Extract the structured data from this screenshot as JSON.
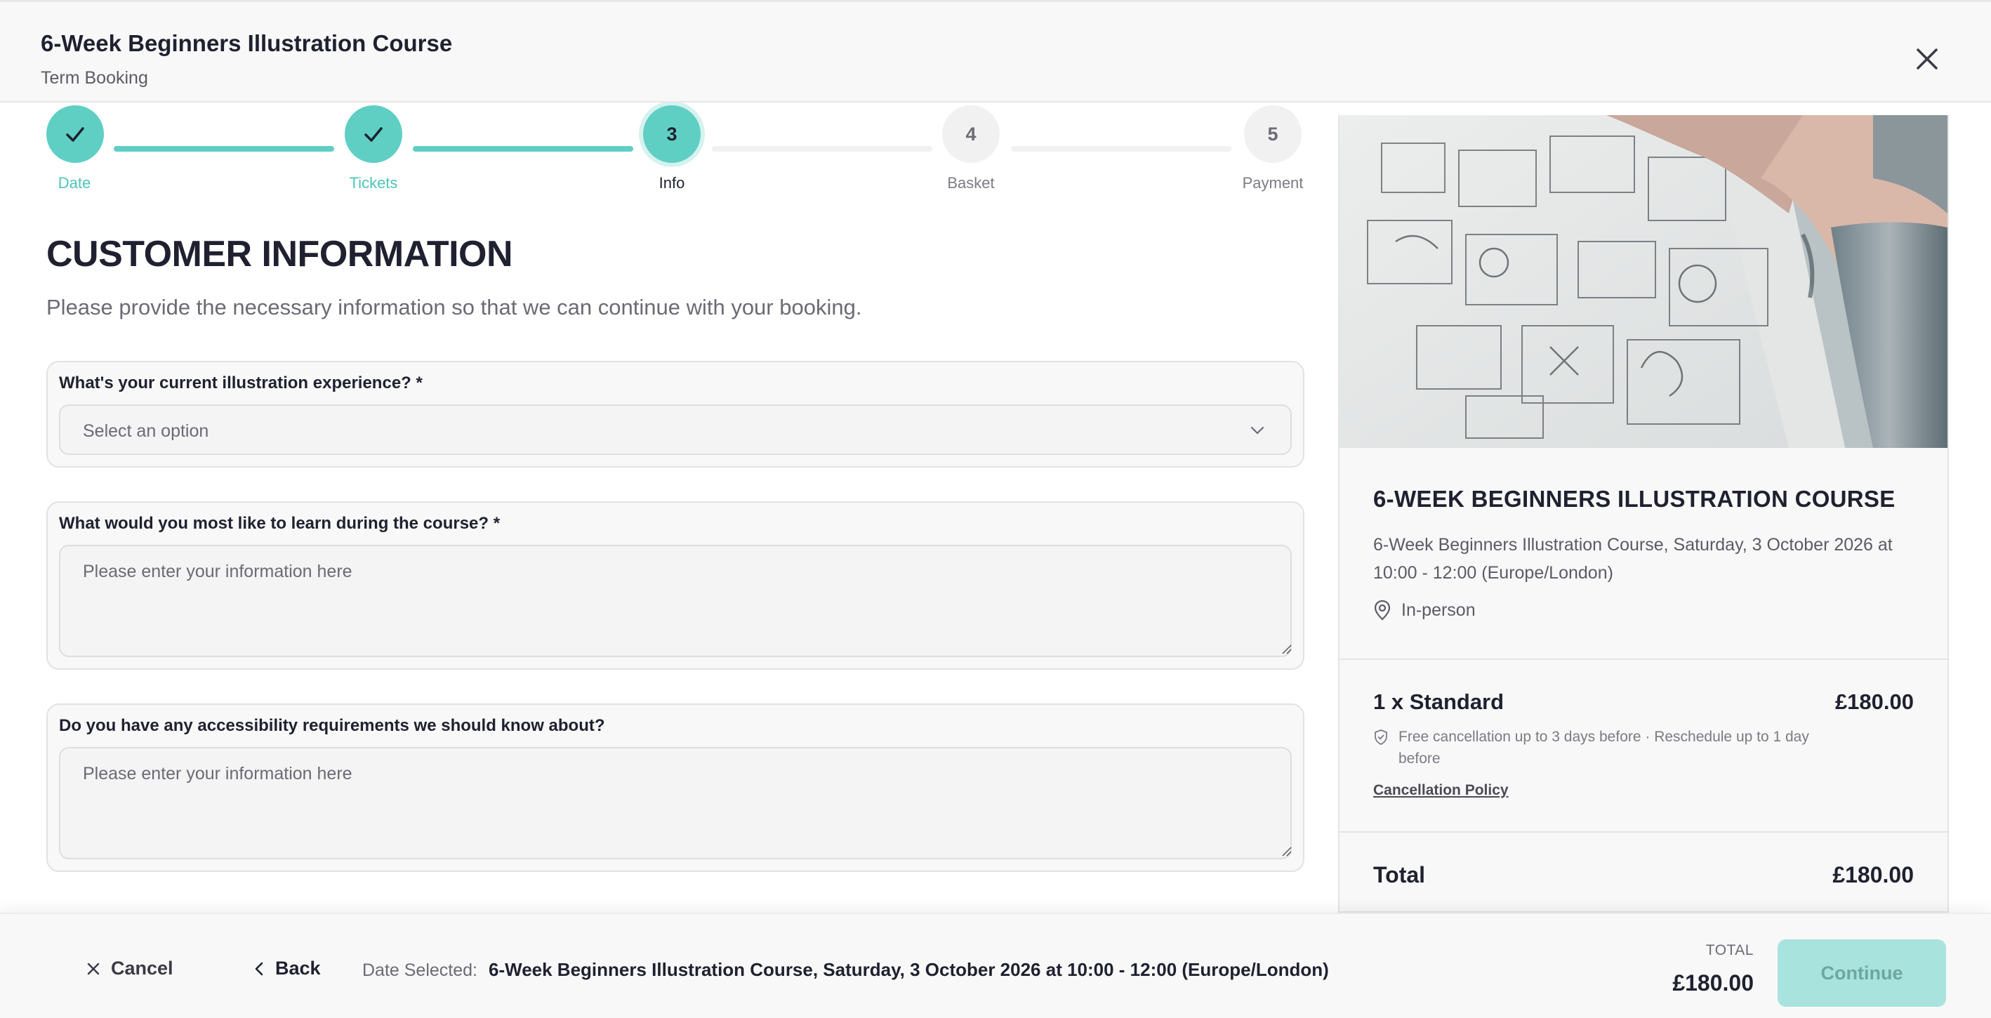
{
  "header": {
    "title": "6-Week Beginners Illustration Course",
    "subtitle": "Term Booking"
  },
  "stepper": {
    "steps": [
      {
        "label": "Date",
        "number": "1",
        "state": "done"
      },
      {
        "label": "Tickets",
        "number": "2",
        "state": "done"
      },
      {
        "label": "Info",
        "number": "3",
        "state": "active"
      },
      {
        "label": "Basket",
        "number": "4",
        "state": "todo"
      },
      {
        "label": "Payment",
        "number": "5",
        "state": "todo"
      }
    ]
  },
  "form": {
    "heading": "CUSTOMER INFORMATION",
    "description": "Please provide the necessary information so that we can continue with your booking.",
    "questions": [
      {
        "label": "What's your current illustration experience? *",
        "placeholder": "Select an option"
      },
      {
        "label": "What would you most like to learn during the course? *",
        "placeholder": "Please enter your information here"
      },
      {
        "label": "Do you have any accessibility requirements we should know about?",
        "placeholder": "Please enter your information here"
      }
    ]
  },
  "summary": {
    "course_title": "6-WEEK BEGINNERS ILLUSTRATION COURSE",
    "course_desc": "6-Week Beginners Illustration Course, Saturday, 3 October 2026 at 10:00 - 12:00 (Europe/London)",
    "location": "In-person",
    "ticket_name": "1 x Standard",
    "ticket_price": "£180.00",
    "ticket_note": "Free cancellation up to 3 days before · Reschedule up to 1 day before",
    "cancellation_link": "Cancellation Policy",
    "total_label": "Total",
    "total_value": "£180.00"
  },
  "footer": {
    "cancel": "Cancel",
    "back": "Back",
    "date_label": "Date Selected:",
    "date_value": "6-Week Beginners Illustration Course, Saturday, 3 October 2026 at 10:00 - 12:00 (Europe/London)",
    "total_caption": "TOTAL",
    "total_amount": "£180.00",
    "continue": "Continue"
  },
  "colors": {
    "accent": "#5fcfc4",
    "accent_light": "#a9e3dd",
    "text_dark": "#1f2130",
    "text_muted": "#6a6b74"
  }
}
